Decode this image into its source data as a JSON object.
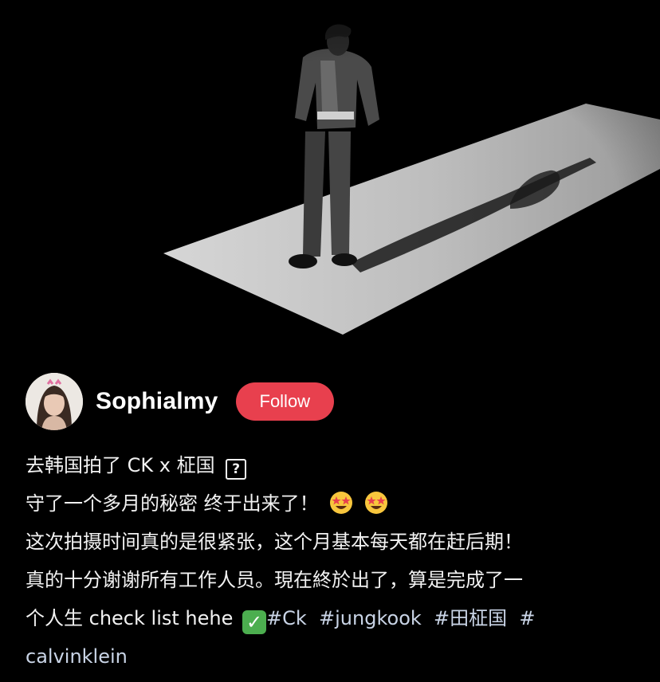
{
  "post": {
    "author": {
      "name": "Sophialmy",
      "follow_label": "Follow"
    },
    "caption": {
      "line1": "去韩国拍了 CK x 柾国",
      "line1_icon": "?",
      "line2": "守了一个多月的秘密 终于出来了！",
      "line2_emoji": "star-struck-emoji",
      "line3": "这次拍摄时间真的是很紧张，这个月基本每天都在赶后期！",
      "line4": "真的十分谢谢所有工作人员。現在終於出了，算是完成了一",
      "line5": "个人生 check list hehe",
      "line5_emoji": "check-mark-emoji",
      "hashtags": [
        "#Ck",
        "#jungkook",
        "#田柾国",
        "#",
        "calvinklein"
      ]
    }
  },
  "colors": {
    "background": "#000000",
    "follow_button": "#e8404e",
    "text": "#f2f2f2",
    "hashtag": "#c9d4e6"
  }
}
